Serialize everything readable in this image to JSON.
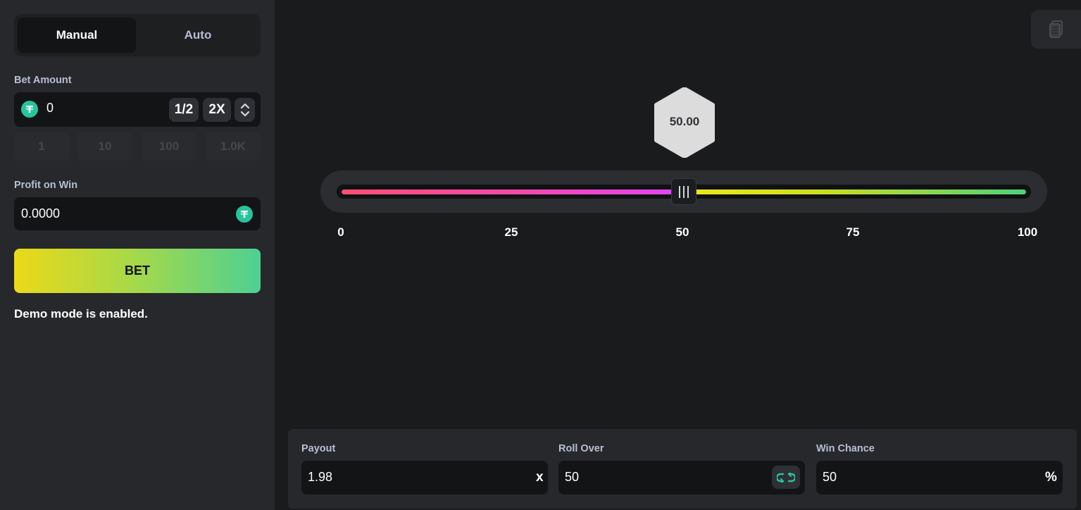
{
  "tabs": [
    {
      "label": "Manual",
      "active": true
    },
    {
      "label": "Auto",
      "active": false
    }
  ],
  "bet_amount": {
    "label": "Bet Amount",
    "value": "0",
    "currency_icon": "tether-icon",
    "half_label": "1/2",
    "double_label": "2X"
  },
  "quick_amounts": [
    "1",
    "10",
    "100",
    "1.0K"
  ],
  "profit": {
    "label": "Profit on Win",
    "value": "0.0000",
    "currency_icon": "tether-icon"
  },
  "bet_button": "BET",
  "demo_message": "Demo mode is enabled.",
  "result": {
    "value": "50.00"
  },
  "slider": {
    "value": 50,
    "min": 0,
    "max": 100,
    "ticks": [
      "0",
      "25",
      "50",
      "75",
      "100"
    ],
    "lose_color": "#ff4f72",
    "win_color": "#4fd07b"
  },
  "payout": {
    "label": "Payout",
    "value": "1.98",
    "suffix": "x"
  },
  "roll_over": {
    "label": "Roll Over",
    "value": "50",
    "swap_icon": "swap-icon"
  },
  "win_chance": {
    "label": "Win Chance",
    "value": "50",
    "suffix": "%"
  },
  "colors": {
    "accent_green": "#26c59c",
    "bet_gradient_start": "#ebd918",
    "bet_gradient_end": "#4ed092"
  }
}
